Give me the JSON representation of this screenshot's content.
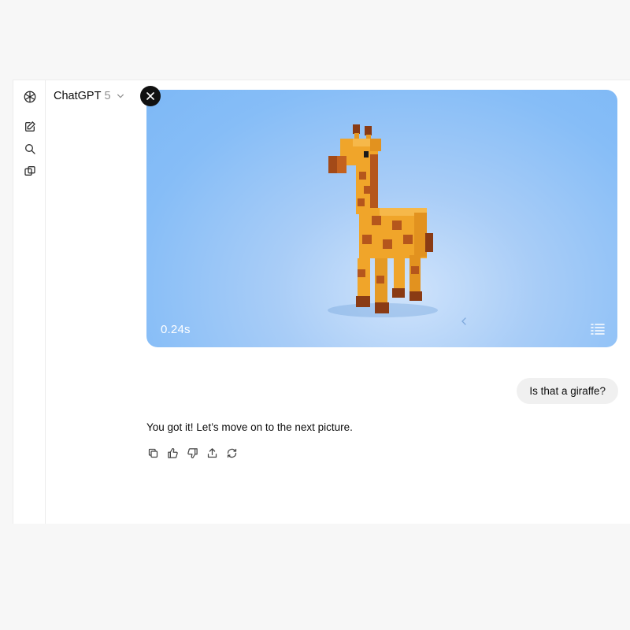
{
  "header": {
    "model_name": "ChatGPT",
    "model_version": "5"
  },
  "sidebar": {
    "icons": [
      "openai-logo-icon",
      "new-chat-icon",
      "search-icon",
      "library-icon"
    ]
  },
  "image_viewer": {
    "timer": "0.24s",
    "subject": "voxel giraffe",
    "background_color": "#86bdf7"
  },
  "conversation": {
    "user_message": "Is that a giraffe?",
    "assistant_message": "You got it! Let’s move on to the next picture."
  },
  "message_actions": [
    "copy-icon",
    "thumbs-up-icon",
    "thumbs-down-icon",
    "share-icon",
    "regenerate-icon"
  ],
  "colors": {
    "giraffe_body": "#f0a52a",
    "giraffe_spots": "#b5561c",
    "bubble": "#f0f0f0"
  }
}
